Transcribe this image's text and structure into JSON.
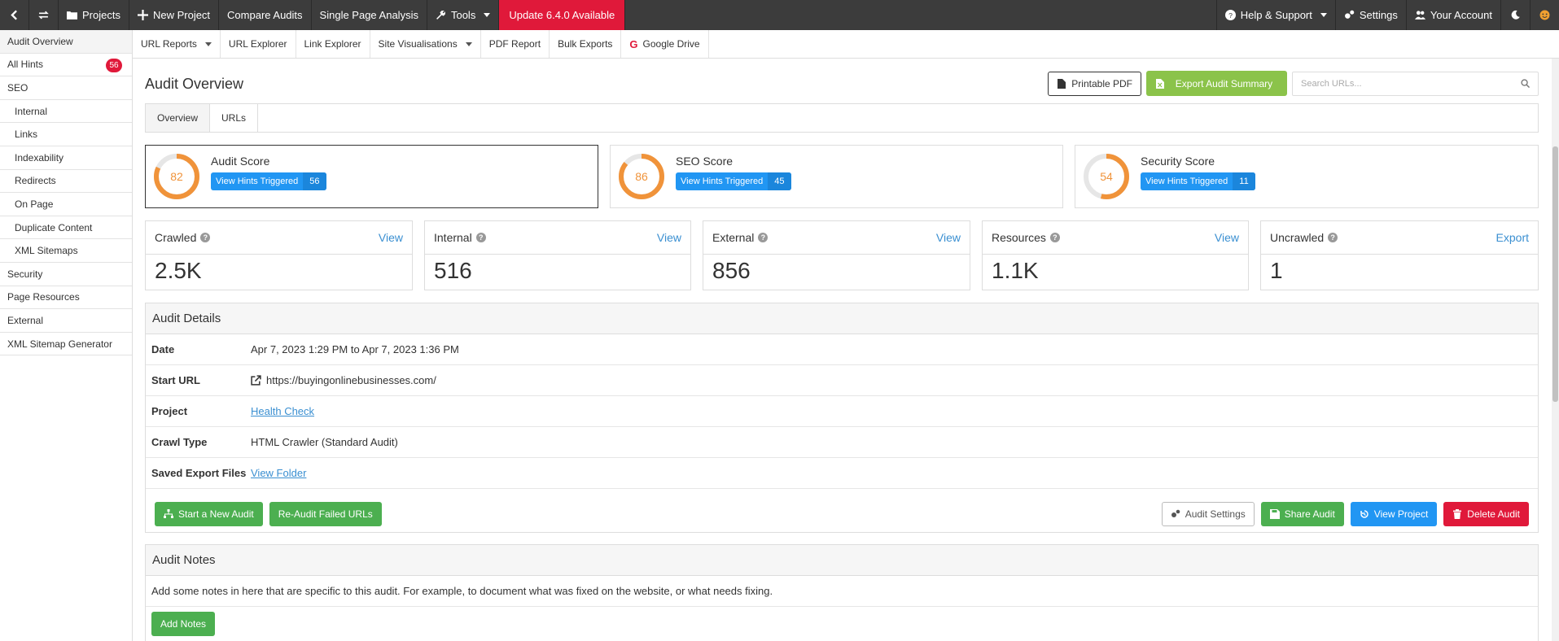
{
  "topbar": {
    "projects": "Projects",
    "new_project": "New Project",
    "compare_audits": "Compare Audits",
    "single_page": "Single Page Analysis",
    "tools": "Tools",
    "update": "Update 6.4.0 Available",
    "help": "Help & Support",
    "settings": "Settings",
    "account": "Your Account"
  },
  "sidebar": {
    "items": [
      {
        "label": "Audit Overview"
      },
      {
        "label": "All Hints",
        "badge": "56"
      },
      {
        "label": "SEO"
      },
      {
        "label": "Internal"
      },
      {
        "label": "Links"
      },
      {
        "label": "Indexability"
      },
      {
        "label": "Redirects"
      },
      {
        "label": "On Page"
      },
      {
        "label": "Duplicate Content"
      },
      {
        "label": "XML Sitemaps"
      },
      {
        "label": "Security"
      },
      {
        "label": "Page Resources"
      },
      {
        "label": "External"
      },
      {
        "label": "XML Sitemap Generator"
      }
    ]
  },
  "subnav": {
    "url_reports": "URL Reports",
    "url_explorer": "URL Explorer",
    "link_explorer": "Link Explorer",
    "site_vis": "Site Visualisations",
    "pdf_report": "PDF Report",
    "bulk_exports": "Bulk Exports",
    "google_drive": "Google Drive"
  },
  "header": {
    "title": "Audit Overview",
    "printable_pdf": "Printable PDF",
    "export_summary": "Export Audit Summary",
    "search_placeholder": "Search URLs..."
  },
  "tabs": {
    "overview": "Overview",
    "urls": "URLs"
  },
  "scores": [
    {
      "title": "Audit Score",
      "value": "82",
      "hints_label": "View Hints Triggered",
      "hints": "56",
      "fraction": 0.82
    },
    {
      "title": "SEO Score",
      "value": "86",
      "hints_label": "View Hints Triggered",
      "hints": "45",
      "fraction": 0.86
    },
    {
      "title": "Security Score",
      "value": "54",
      "hints_label": "View Hints Triggered",
      "hints": "11",
      "fraction": 0.54
    }
  ],
  "stats": [
    {
      "title": "Crawled",
      "link": "View",
      "value": "2.5K"
    },
    {
      "title": "Internal",
      "link": "View",
      "value": "516"
    },
    {
      "title": "External",
      "link": "View",
      "value": "856"
    },
    {
      "title": "Resources",
      "link": "View",
      "value": "1.1K"
    },
    {
      "title": "Uncrawled",
      "link": "Export",
      "value": "1"
    }
  ],
  "details": {
    "title": "Audit Details",
    "rows": {
      "date_key": "Date",
      "date_val": "Apr 7, 2023 1:29 PM to Apr 7, 2023 1:36 PM",
      "start_key": "Start URL",
      "start_val": "https://buyingonlinebusinesses.com/",
      "project_key": "Project",
      "project_val": "Health Check",
      "crawl_key": "Crawl Type",
      "crawl_val": "HTML Crawler (Standard Audit)",
      "saved_key": "Saved Export Files",
      "saved_val": "View Folder"
    },
    "buttons": {
      "start_new": "Start a New Audit",
      "reaudit": "Re-Audit Failed URLs",
      "settings": "Audit Settings",
      "share": "Share Audit",
      "view_project": "View Project",
      "delete": "Delete Audit"
    }
  },
  "notes": {
    "title": "Audit Notes",
    "text": "Add some notes in here that are specific to this audit. For example, to document what was fixed on the website, or what needs fixing.",
    "add": "Add Notes"
  },
  "colors": {
    "accent_orange": "#f0933a",
    "blue": "#2196f3",
    "green": "#4caf50",
    "red": "#e0193a"
  }
}
